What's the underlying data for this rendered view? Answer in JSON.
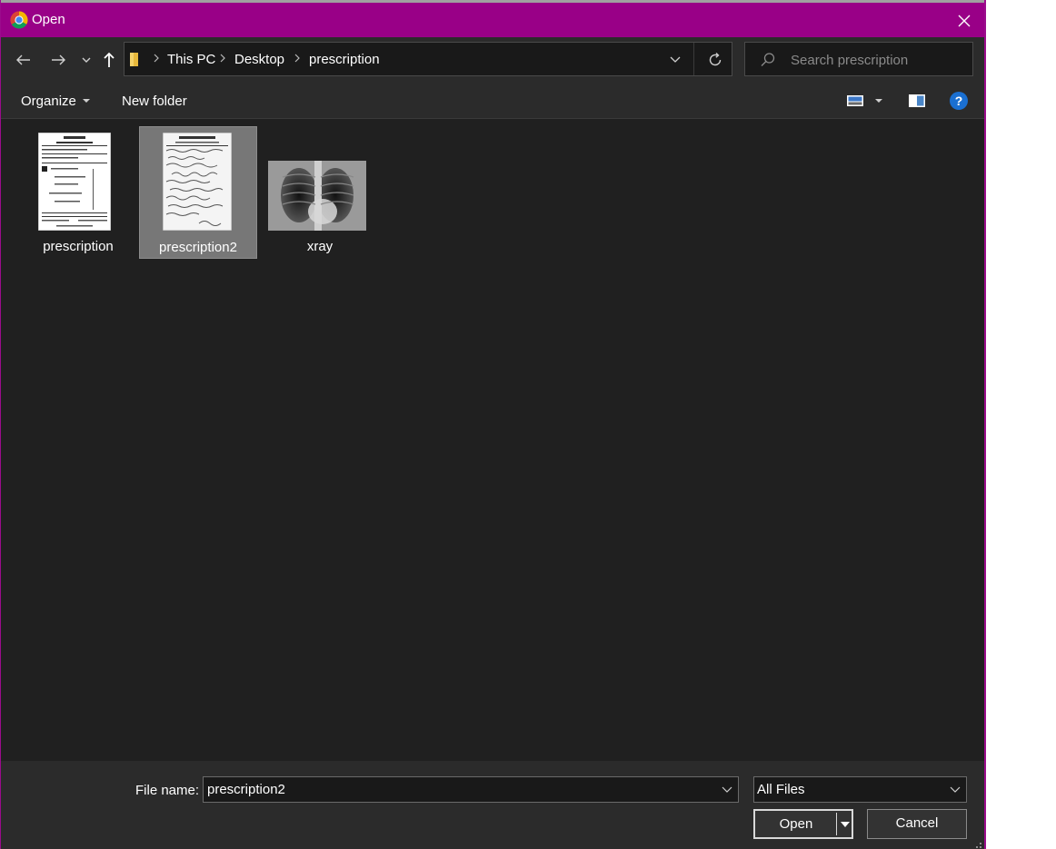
{
  "window": {
    "title": "Open",
    "app_icon": "chrome-icon",
    "accent": "#990087"
  },
  "nav": {
    "back_icon": "arrow-left-icon",
    "forward_icon": "arrow-right-icon",
    "recent_icon": "chevron-down-icon",
    "up_icon": "arrow-up-icon",
    "breadcrumbs": [
      "This PC",
      "Desktop",
      "prescription"
    ],
    "refresh_icon": "refresh-icon"
  },
  "search": {
    "placeholder": "Search prescription"
  },
  "toolbar": {
    "organize_label": "Organize",
    "new_folder_label": "New folder",
    "help_label": "?"
  },
  "files": [
    {
      "name": "prescription",
      "type": "document-thumbnail",
      "selected": false
    },
    {
      "name": "prescription2",
      "type": "handwritten-thumbnail",
      "selected": true
    },
    {
      "name": "xray",
      "type": "xray-thumbnail",
      "selected": false
    }
  ],
  "footer": {
    "filename_label": "File name:",
    "filename_value": "prescription2",
    "filter_value": "All Files",
    "open_label": "Open",
    "cancel_label": "Cancel"
  }
}
